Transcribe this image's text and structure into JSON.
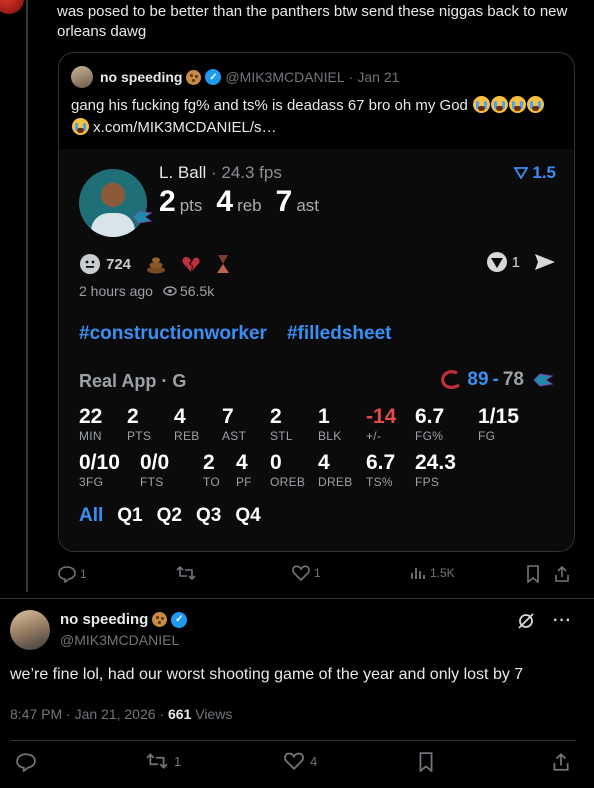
{
  "reply": {
    "text": "was posed to be better than the panthers btw send these niggas back to new orleans dawg"
  },
  "quote": {
    "name": "no speeding",
    "handle": "@MIK3MCDANIEL",
    "separator": "·",
    "date": "Jan 21",
    "text": "gang his fucking fg% and ts% is deadass 67 bro oh my God",
    "link": "x.com/MIK3MCDANIEL/s…",
    "card": {
      "player_name": "L. Ball",
      "fps_label": "· 24.3 fps",
      "pts": "2",
      "pts_label": "pts",
      "reb": "4",
      "reb_label": "reb",
      "ast": "7",
      "ast_label": "ast",
      "delta": "1.5",
      "reactions": {
        "count": "724"
      },
      "time_ago": "2 hours ago",
      "views": "56.5k",
      "share_count": "1",
      "tags": [
        "#constructionworker",
        "#filledsheet"
      ],
      "box_title": "Real App · G",
      "score_home": "89",
      "score_sep": "-",
      "score_away": "78",
      "stats_row1": [
        {
          "v": "22",
          "l": "MIN"
        },
        {
          "v": "2",
          "l": "PTS"
        },
        {
          "v": "4",
          "l": "REB"
        },
        {
          "v": "7",
          "l": "AST"
        },
        {
          "v": "2",
          "l": "STL"
        },
        {
          "v": "1",
          "l": "BLK"
        },
        {
          "v": "-14",
          "l": "+/-"
        },
        {
          "v": "6.7",
          "l": "FG%"
        },
        {
          "v": "1/15",
          "l": "FG"
        }
      ],
      "stats_row2": [
        {
          "v": "0/10",
          "l": "3FG"
        },
        {
          "v": "0/0",
          "l": "FTS"
        },
        {
          "v": "2",
          "l": "TO"
        },
        {
          "v": "4",
          "l": "PF"
        },
        {
          "v": "0",
          "l": "OREB"
        },
        {
          "v": "4",
          "l": "DREB"
        },
        {
          "v": "6.7",
          "l": "TS%"
        },
        {
          "v": "24.3",
          "l": "FPS"
        }
      ],
      "quarters": [
        "All",
        "Q1",
        "Q2",
        "Q3",
        "Q4"
      ]
    }
  },
  "reply_actions": {
    "replies": "1",
    "likes": "1",
    "views": "1.5K"
  },
  "main": {
    "name": "no speeding",
    "handle": "@MIK3MCDANIEL",
    "text": "we’re fine lol, had our worst shooting game of the year and only lost by 7",
    "time": "8:47 PM · Jan 21, 2026 · ",
    "views_count": "661",
    "views_label": " Views",
    "retweets": "1",
    "likes": "4"
  },
  "colors": {
    "accent": "#1d9bf0",
    "stat_blue": "#3a8ff5",
    "negative": "#e84a4a"
  }
}
